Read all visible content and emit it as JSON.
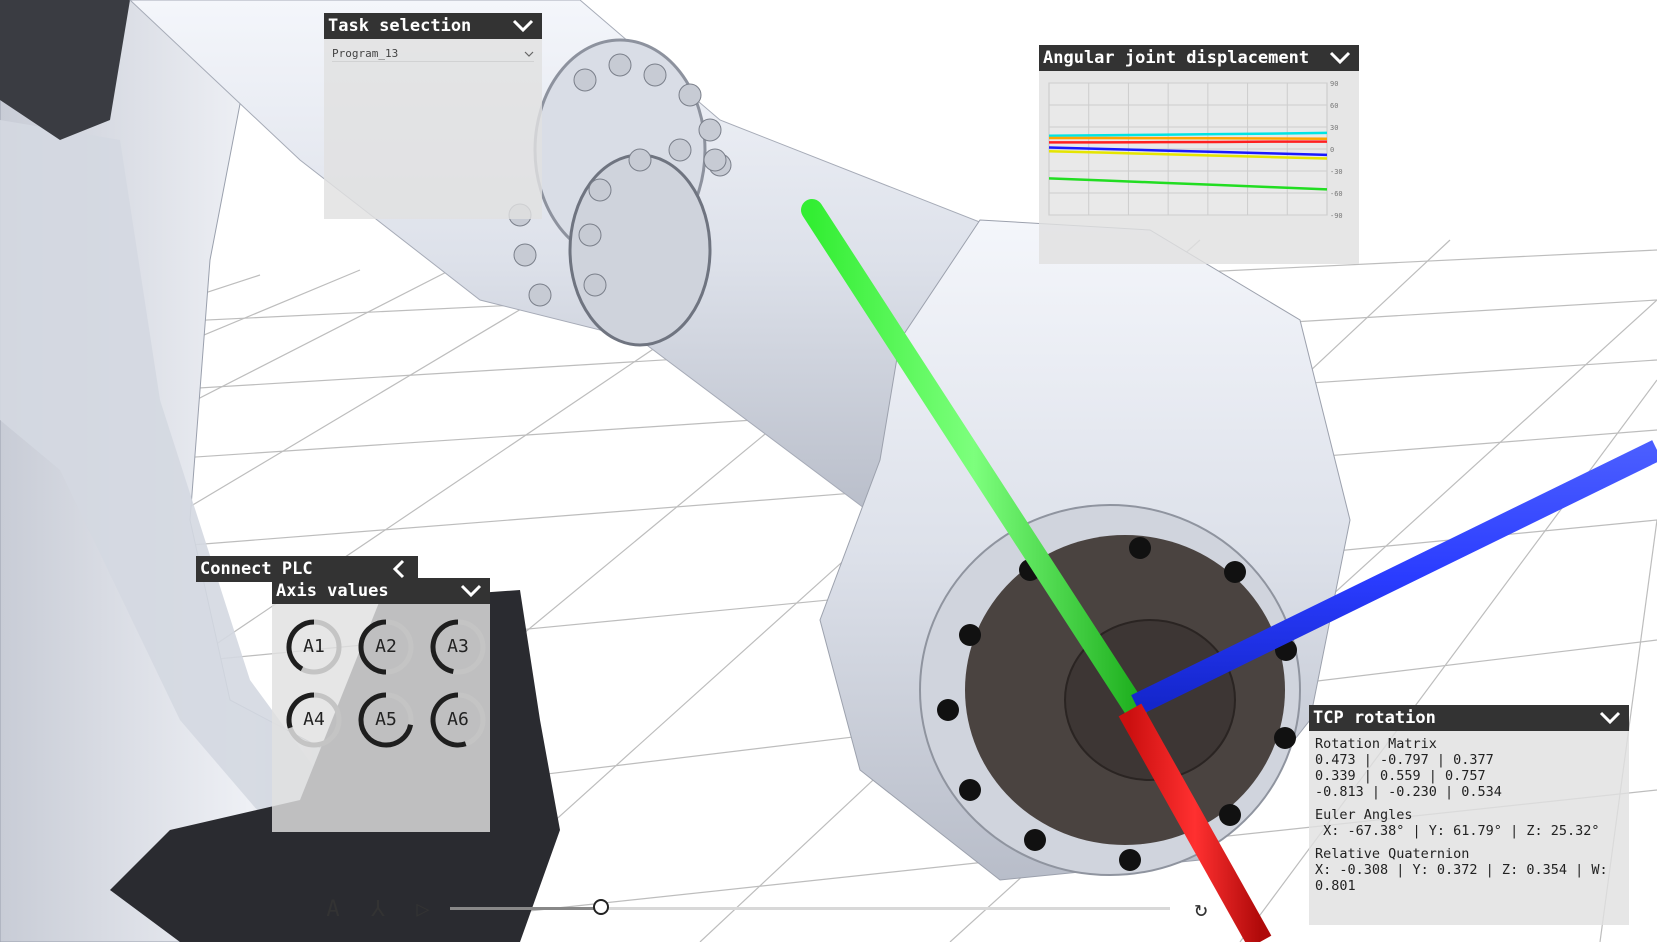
{
  "task_selection": {
    "title": "Task selection",
    "program": "Program_13"
  },
  "angular_joint": {
    "title": "Angular joint displacement",
    "y_ticks": [
      "90",
      "60",
      "30",
      "0",
      "-30",
      "-60",
      "-90"
    ],
    "chart_data": {
      "type": "line",
      "ylim": [
        -90,
        90
      ],
      "grid": true,
      "series": [
        {
          "color": "#00e5e5",
          "values": [
            18,
            18.7,
            19.5,
            20.2,
            21,
            22
          ]
        },
        {
          "color": "#ffa500",
          "values": [
            15,
            15,
            14.8,
            14.6,
            14.4,
            14
          ]
        },
        {
          "color": "#ff2020",
          "values": [
            9,
            9,
            9.3,
            9.6,
            10,
            10
          ]
        },
        {
          "color": "#1a1aff",
          "values": [
            2,
            0,
            -2,
            -4,
            -6,
            -8
          ]
        },
        {
          "color": "#e5e500",
          "values": [
            -3,
            -5,
            -7,
            -9,
            -11,
            -13
          ]
        },
        {
          "color": "#22dd22",
          "values": [
            -40,
            -43,
            -46,
            -49,
            -52,
            -55
          ]
        }
      ]
    }
  },
  "connect_plc": {
    "title": "Connect PLC"
  },
  "axis_values": {
    "title": "Axis values",
    "axes": [
      {
        "label": "A1",
        "fraction": 0.42
      },
      {
        "label": "A2",
        "fraction": 0.5
      },
      {
        "label": "A3",
        "fraction": 0.47
      },
      {
        "label": "A4",
        "fraction": 0.3
      },
      {
        "label": "A5",
        "fraction": 0.72
      },
      {
        "label": "A6",
        "fraction": 0.55
      }
    ]
  },
  "tcp_rotation": {
    "title": "TCP rotation",
    "rotation_matrix_label": "Rotation Matrix",
    "rotation_matrix_rows": [
      "0.473 | -0.797 | 0.377",
      "0.339 | 0.559 | 0.757",
      "-0.813 | -0.230 | 0.534"
    ],
    "euler_label": "Euler Angles",
    "euler_value": " X: -67.38° | Y: 61.79° | Z: 25.32°",
    "quaternion_label": "Relative Quaternion",
    "quaternion_value": "X: -0.308 | Y: 0.372 | Z: 0.354 | W:",
    "quaternion_value2": "0.801"
  },
  "toolbar": {
    "font_button": "A",
    "axes_button": "⅄",
    "play_button": "▷",
    "reset_button": "↻",
    "timeline_fraction": 0.21
  },
  "colors": {
    "panel_header": "#333333",
    "axis_x": "#ee1c1c",
    "axis_y": "#22dd22",
    "axis_z": "#1f3dff",
    "robot_body": "#e4e7ee"
  }
}
